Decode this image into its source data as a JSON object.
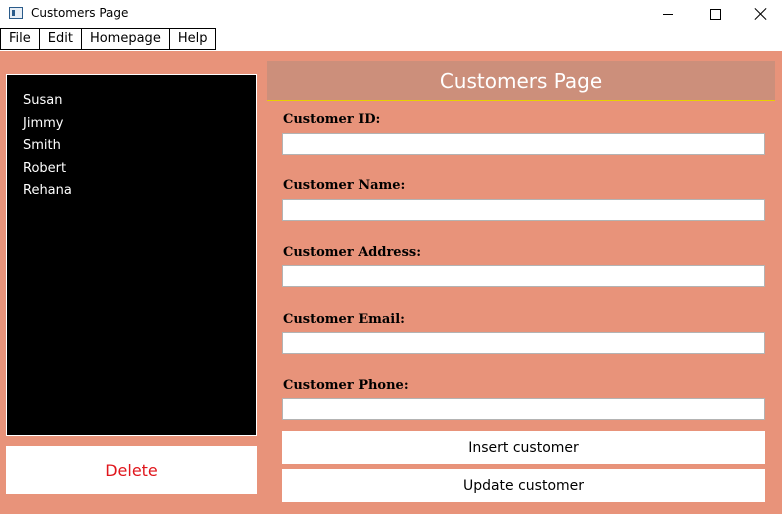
{
  "window": {
    "title": "Customers Page",
    "icon": "app-window-icon"
  },
  "menu": {
    "items": [
      "File",
      "Edit",
      "Homepage",
      "Help"
    ]
  },
  "customers": {
    "list": [
      "Susan",
      "Jimmy",
      "Smith",
      "Robert",
      "Rehana"
    ],
    "delete_label": "Delete"
  },
  "form": {
    "heading": "Customers Page",
    "fields": [
      {
        "label": "Customer ID:",
        "value": ""
      },
      {
        "label": "Customer Name:",
        "value": ""
      },
      {
        "label": "Customer Address:",
        "value": ""
      },
      {
        "label": "Customer Email:",
        "value": ""
      },
      {
        "label": "Customer Phone:",
        "value": ""
      }
    ],
    "insert_label": "Insert customer",
    "update_label": "Update customer"
  },
  "colors": {
    "background": "#e8937a",
    "header": "#cc8f7b",
    "delete_text": "#e0161c",
    "list_background": "#000000"
  }
}
